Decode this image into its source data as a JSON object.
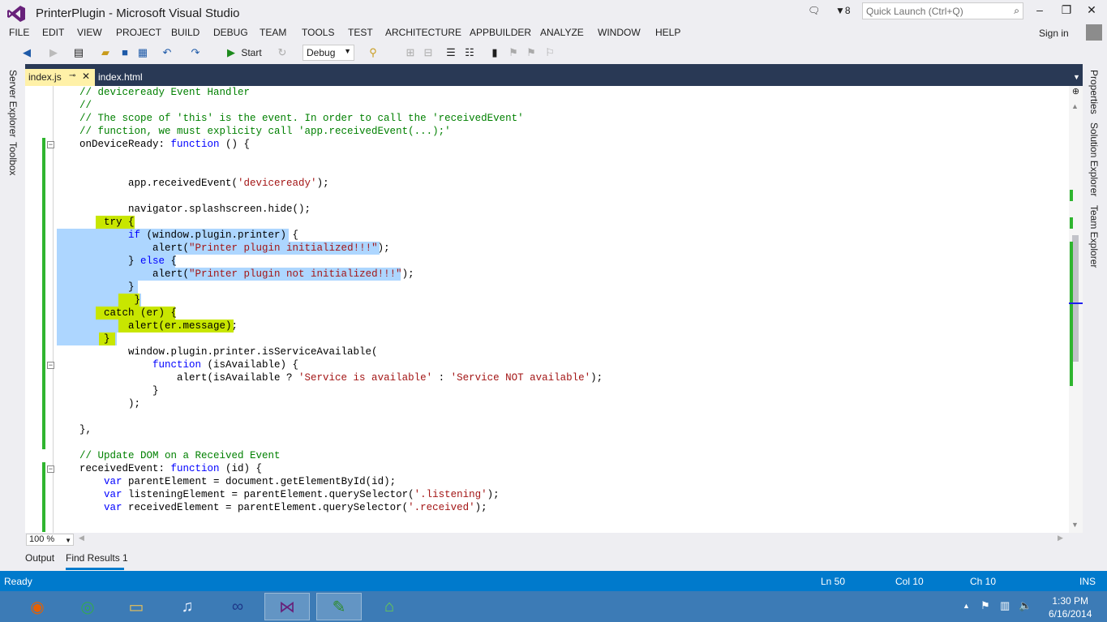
{
  "window": {
    "title": "PrinterPlugin - Microsoft Visual Studio",
    "notifications": "8",
    "quick_launch_placeholder": "Quick Launch (Ctrl+Q)"
  },
  "menu": [
    "FILE",
    "EDIT",
    "VIEW",
    "PROJECT",
    "BUILD",
    "DEBUG",
    "TEAM",
    "TOOLS",
    "TEST",
    "ARCHITECTURE",
    "APPBUILDER",
    "ANALYZE",
    "WINDOW",
    "HELP"
  ],
  "signin": "Sign in",
  "toolbar": {
    "start_label": "Start",
    "config": "Debug"
  },
  "left_tabs": [
    "Server Explorer",
    "Toolbox"
  ],
  "right_tabs": [
    "Properties",
    "Solution Explorer",
    "Team Explorer"
  ],
  "tabs": {
    "active": "index.js",
    "inactive": "index.html"
  },
  "zoom": "100 %",
  "bottom_tabs": [
    "Output",
    "Find Results 1"
  ],
  "status": {
    "ready": "Ready",
    "ln": "Ln 50",
    "col": "Col 10",
    "ch": "Ch 10",
    "mode": "INS"
  },
  "clock": {
    "time": "1:30 PM",
    "date": "6/16/2014"
  },
  "colors": {
    "status_bar": "#007acc",
    "taskbar": "#3c7bb6",
    "selection": "#add6ff",
    "highlight": "#c8e600",
    "active_tab": "#fff1a8"
  }
}
